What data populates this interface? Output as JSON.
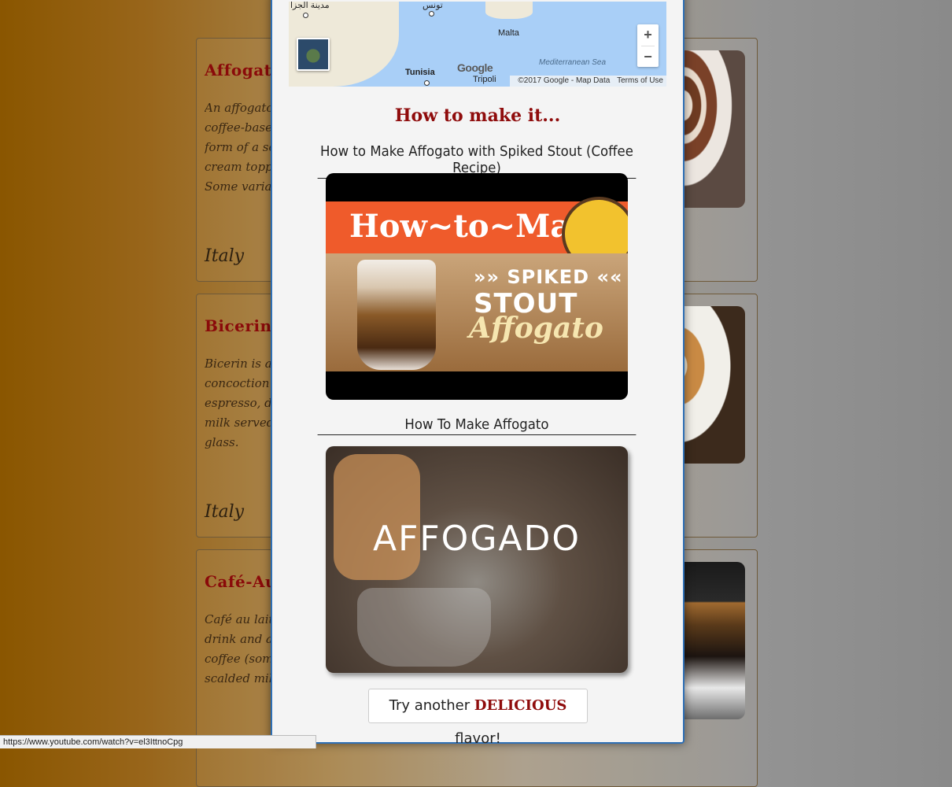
{
  "cards": [
    {
      "title": "Affogato",
      "description": "An affogato (Italian for \"drowned\") is a coffee-based beverage. It usually takes the form of a scoop of vanilla gelato or ice cream topped with a shot of hot espresso. Some variations",
      "origin": "Italy"
    },
    {
      "title": "Bicerin",
      "description": "Bicerin is a traditional warm coffee concoction native to Turin, Italy, made of espresso, drinking chocolate and whole milk served layered in a small rounded glass.",
      "origin": "Italy"
    },
    {
      "title": "Café-Au-Lait",
      "description": "Café au lait is a French/European coffee drink and a coffee with strong or bold coffee (sometimes espresso) mixed with scalded milk",
      "origin": ""
    }
  ],
  "map": {
    "labels": {
      "city1": "مدينة الجزا",
      "city2": "تونس",
      "malta": "Malta",
      "tunisia": "Tunisia",
      "tripoli": "Tripoli",
      "sea": "Mediterranean Sea"
    },
    "zoom_in": "+",
    "zoom_out": "−",
    "google": "Google",
    "copyright": "©2017 Google - Map Data",
    "terms": "Terms of Use"
  },
  "modal": {
    "how_title": "How to make it...",
    "videos": [
      {
        "title": "How to Make Affogato with Spiked Stout (Coffee Recipe)",
        "thumb_banner": "How~to~Make",
        "thumb_line1": "»» SPIKED ««",
        "thumb_line2": "STOUT",
        "thumb_line3": "Affogato"
      },
      {
        "title": "How To Make Affogato",
        "thumb_text": "AFFOGADO"
      }
    ],
    "try_prefix": "Try another ",
    "try_highlight": "DELICIOUS",
    "try_suffix": " flavor!"
  },
  "status_url": "https://www.youtube.com/watch?v=el3IttnoCpg",
  "colors": {
    "accent": "#8f0c0c",
    "modal_border": "#2e6fb5"
  }
}
